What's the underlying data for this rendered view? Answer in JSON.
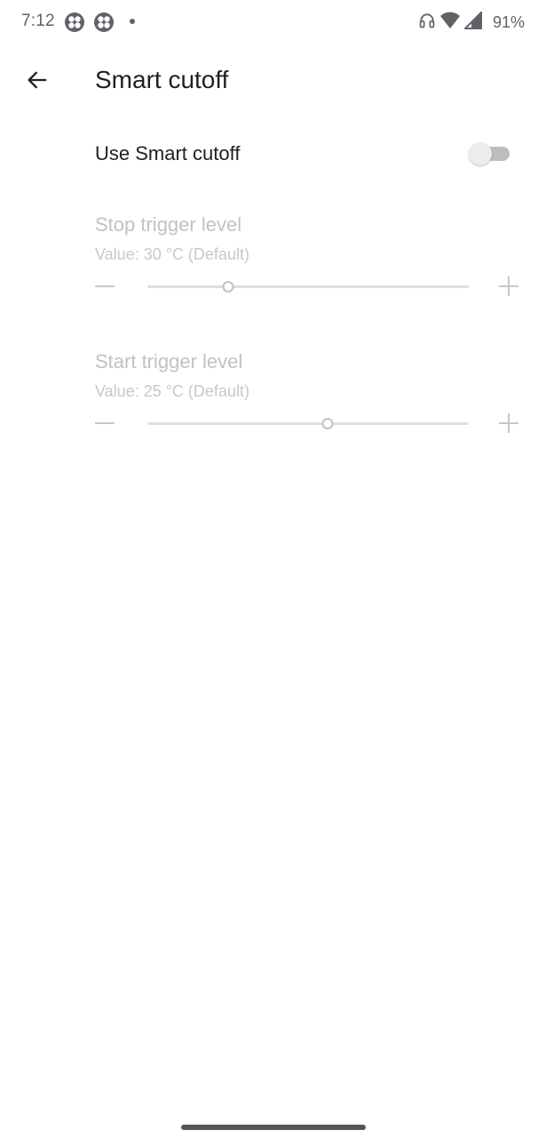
{
  "status_bar": {
    "time": "7:12",
    "notification_icons": [
      "clover-icon",
      "clover-icon"
    ],
    "battery_percent": "91%",
    "indicator_icons": [
      "headphones-icon",
      "wifi-icon",
      "cell-signal-icon"
    ]
  },
  "app_bar": {
    "back_icon": "arrow-back-icon",
    "title": "Smart cutoff"
  },
  "settings": {
    "use_smart_cutoff": {
      "label": "Use Smart cutoff",
      "enabled": false
    },
    "stop_trigger": {
      "title": "Stop trigger level",
      "summary": "Value: 30 °C (Default)",
      "value": 30,
      "unit": "°C",
      "slider_fraction": 0.25,
      "enabled": false
    },
    "start_trigger": {
      "title": "Start trigger level",
      "summary": "Value: 25 °C (Default)",
      "value": 25,
      "unit": "°C",
      "slider_fraction": 0.56,
      "enabled": false
    }
  },
  "colors": {
    "text_primary": "#202124",
    "text_disabled": "#c2c2c2",
    "switch_off_track": "#bdbdbd",
    "switch_off_thumb": "#ececec"
  }
}
